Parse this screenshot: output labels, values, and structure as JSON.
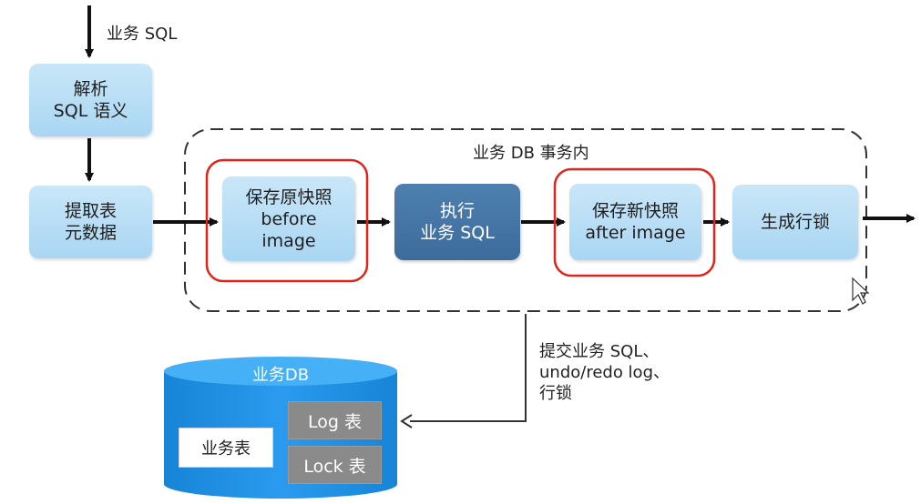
{
  "labels": {
    "input_sql": "业务 SQL",
    "transaction": "业务 DB 事务内",
    "commit": "提交业务 SQL、\nundo/redo log、\n行锁"
  },
  "steps": {
    "parse": "解析\nSQL 语义",
    "extract": "提取表\n元数据",
    "before_image": "保存原快照\nbefore\nimage",
    "execute": "执行\n业务 SQL",
    "after_image": "保存新快照\nafter image",
    "lock": "生成行锁"
  },
  "database": {
    "title": "业务DB",
    "business_table": "业务表",
    "log_table": "Log 表",
    "lock_table": "Lock 表"
  },
  "colors": {
    "step_light": "#b6dcf5",
    "step_dark": "#4676a6",
    "highlight": "#e0241b",
    "db": "#1a8fe0"
  }
}
